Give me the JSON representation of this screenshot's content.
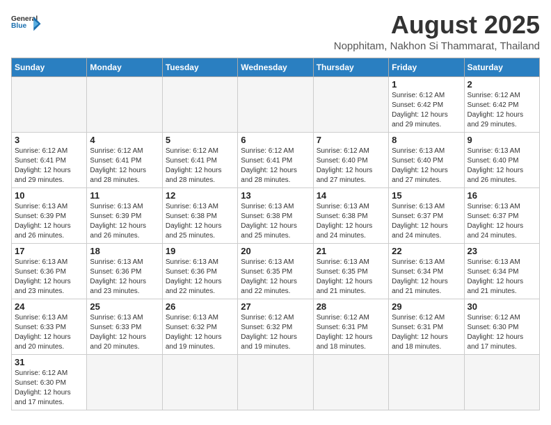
{
  "header": {
    "logo_line1": "General",
    "logo_line2": "Blue",
    "month_year": "August 2025",
    "location": "Nopphitam, Nakhon Si Thammarat, Thailand"
  },
  "days_of_week": [
    "Sunday",
    "Monday",
    "Tuesday",
    "Wednesday",
    "Thursday",
    "Friday",
    "Saturday"
  ],
  "weeks": [
    [
      {
        "day": "",
        "info": ""
      },
      {
        "day": "",
        "info": ""
      },
      {
        "day": "",
        "info": ""
      },
      {
        "day": "",
        "info": ""
      },
      {
        "day": "",
        "info": ""
      },
      {
        "day": "1",
        "info": "Sunrise: 6:12 AM\nSunset: 6:42 PM\nDaylight: 12 hours and 29 minutes."
      },
      {
        "day": "2",
        "info": "Sunrise: 6:12 AM\nSunset: 6:42 PM\nDaylight: 12 hours and 29 minutes."
      }
    ],
    [
      {
        "day": "3",
        "info": "Sunrise: 6:12 AM\nSunset: 6:41 PM\nDaylight: 12 hours and 29 minutes."
      },
      {
        "day": "4",
        "info": "Sunrise: 6:12 AM\nSunset: 6:41 PM\nDaylight: 12 hours and 28 minutes."
      },
      {
        "day": "5",
        "info": "Sunrise: 6:12 AM\nSunset: 6:41 PM\nDaylight: 12 hours and 28 minutes."
      },
      {
        "day": "6",
        "info": "Sunrise: 6:12 AM\nSunset: 6:41 PM\nDaylight: 12 hours and 28 minutes."
      },
      {
        "day": "7",
        "info": "Sunrise: 6:12 AM\nSunset: 6:40 PM\nDaylight: 12 hours and 27 minutes."
      },
      {
        "day": "8",
        "info": "Sunrise: 6:13 AM\nSunset: 6:40 PM\nDaylight: 12 hours and 27 minutes."
      },
      {
        "day": "9",
        "info": "Sunrise: 6:13 AM\nSunset: 6:40 PM\nDaylight: 12 hours and 26 minutes."
      }
    ],
    [
      {
        "day": "10",
        "info": "Sunrise: 6:13 AM\nSunset: 6:39 PM\nDaylight: 12 hours and 26 minutes."
      },
      {
        "day": "11",
        "info": "Sunrise: 6:13 AM\nSunset: 6:39 PM\nDaylight: 12 hours and 26 minutes."
      },
      {
        "day": "12",
        "info": "Sunrise: 6:13 AM\nSunset: 6:38 PM\nDaylight: 12 hours and 25 minutes."
      },
      {
        "day": "13",
        "info": "Sunrise: 6:13 AM\nSunset: 6:38 PM\nDaylight: 12 hours and 25 minutes."
      },
      {
        "day": "14",
        "info": "Sunrise: 6:13 AM\nSunset: 6:38 PM\nDaylight: 12 hours and 24 minutes."
      },
      {
        "day": "15",
        "info": "Sunrise: 6:13 AM\nSunset: 6:37 PM\nDaylight: 12 hours and 24 minutes."
      },
      {
        "day": "16",
        "info": "Sunrise: 6:13 AM\nSunset: 6:37 PM\nDaylight: 12 hours and 24 minutes."
      }
    ],
    [
      {
        "day": "17",
        "info": "Sunrise: 6:13 AM\nSunset: 6:36 PM\nDaylight: 12 hours and 23 minutes."
      },
      {
        "day": "18",
        "info": "Sunrise: 6:13 AM\nSunset: 6:36 PM\nDaylight: 12 hours and 23 minutes."
      },
      {
        "day": "19",
        "info": "Sunrise: 6:13 AM\nSunset: 6:36 PM\nDaylight: 12 hours and 22 minutes."
      },
      {
        "day": "20",
        "info": "Sunrise: 6:13 AM\nSunset: 6:35 PM\nDaylight: 12 hours and 22 minutes."
      },
      {
        "day": "21",
        "info": "Sunrise: 6:13 AM\nSunset: 6:35 PM\nDaylight: 12 hours and 21 minutes."
      },
      {
        "day": "22",
        "info": "Sunrise: 6:13 AM\nSunset: 6:34 PM\nDaylight: 12 hours and 21 minutes."
      },
      {
        "day": "23",
        "info": "Sunrise: 6:13 AM\nSunset: 6:34 PM\nDaylight: 12 hours and 21 minutes."
      }
    ],
    [
      {
        "day": "24",
        "info": "Sunrise: 6:13 AM\nSunset: 6:33 PM\nDaylight: 12 hours and 20 minutes."
      },
      {
        "day": "25",
        "info": "Sunrise: 6:13 AM\nSunset: 6:33 PM\nDaylight: 12 hours and 20 minutes."
      },
      {
        "day": "26",
        "info": "Sunrise: 6:13 AM\nSunset: 6:32 PM\nDaylight: 12 hours and 19 minutes."
      },
      {
        "day": "27",
        "info": "Sunrise: 6:12 AM\nSunset: 6:32 PM\nDaylight: 12 hours and 19 minutes."
      },
      {
        "day": "28",
        "info": "Sunrise: 6:12 AM\nSunset: 6:31 PM\nDaylight: 12 hours and 18 minutes."
      },
      {
        "day": "29",
        "info": "Sunrise: 6:12 AM\nSunset: 6:31 PM\nDaylight: 12 hours and 18 minutes."
      },
      {
        "day": "30",
        "info": "Sunrise: 6:12 AM\nSunset: 6:30 PM\nDaylight: 12 hours and 17 minutes."
      }
    ],
    [
      {
        "day": "31",
        "info": "Sunrise: 6:12 AM\nSunset: 6:30 PM\nDaylight: 12 hours and 17 minutes."
      },
      {
        "day": "",
        "info": ""
      },
      {
        "day": "",
        "info": ""
      },
      {
        "day": "",
        "info": ""
      },
      {
        "day": "",
        "info": ""
      },
      {
        "day": "",
        "info": ""
      },
      {
        "day": "",
        "info": ""
      }
    ]
  ]
}
